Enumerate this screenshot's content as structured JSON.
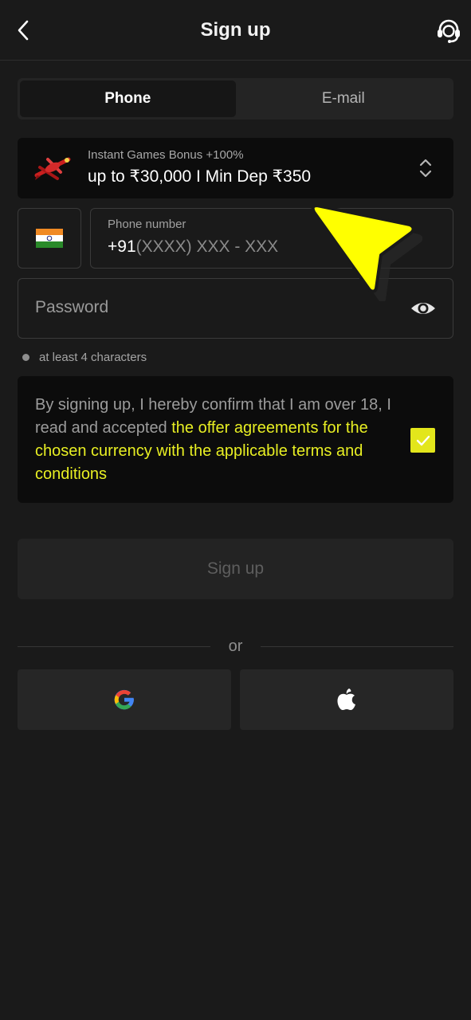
{
  "header": {
    "title": "Sign up",
    "back_icon": "chevron-left-icon",
    "support_icon": "headset-icon"
  },
  "tabs": [
    {
      "label": "Phone",
      "active": true
    },
    {
      "label": "E-mail",
      "active": false
    }
  ],
  "bonus": {
    "subtitle": "Instant Games Bonus +100%",
    "title": "up to ₹30,000 I Min Dep ₹350",
    "icon": "biplane-icon",
    "chevron_icon": "chevron-up-down-icon"
  },
  "phone": {
    "flag_icon": "india-flag-icon",
    "label": "Phone number",
    "code": "+91",
    "mask": "(XXXX) XXX - XXX"
  },
  "password": {
    "placeholder": "Password",
    "eye_icon": "eye-icon"
  },
  "hint": {
    "text": "at least 4 characters"
  },
  "terms": {
    "text": "By signing up, I hereby confirm that I am over 18, I read and accepted ",
    "link": "the offer agreements for the chosen currency with the applicable terms and conditions",
    "checked": true
  },
  "signup_button": {
    "label": "Sign up"
  },
  "divider": {
    "text": "or"
  },
  "social": [
    {
      "name": "google",
      "icon": "google-icon"
    },
    {
      "name": "apple",
      "icon": "apple-icon"
    }
  ],
  "colors": {
    "background": "#1a1a1a",
    "panel": "#0c0c0c",
    "accent": "#e8ef23",
    "pointer": "#ffff00"
  }
}
